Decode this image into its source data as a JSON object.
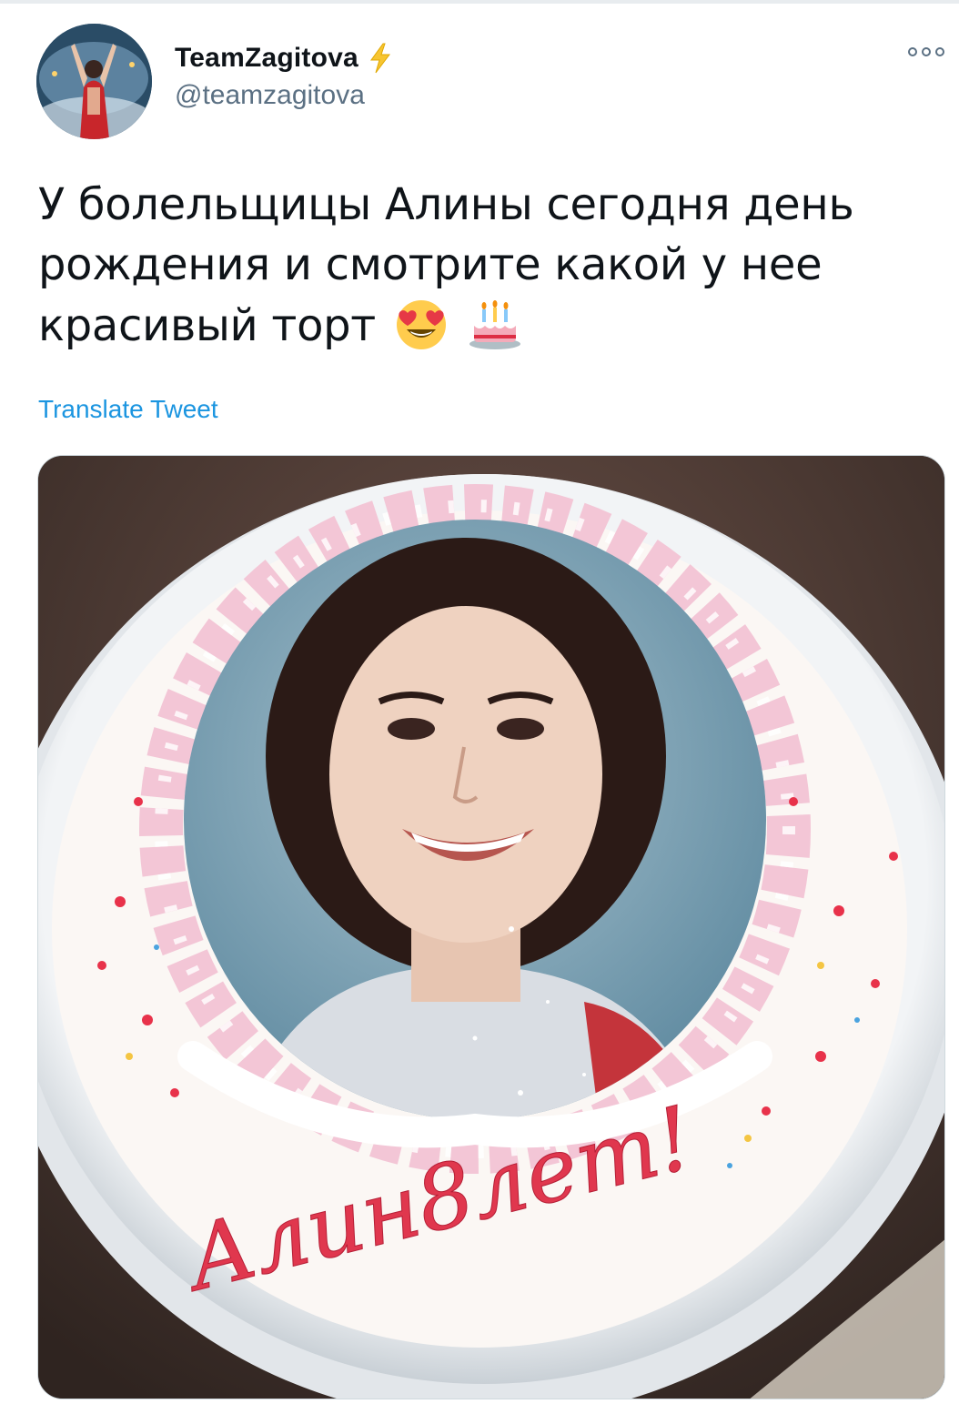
{
  "tweet": {
    "display_name": "TeamZagitova",
    "handle": "@teamzagitova",
    "text": "У болельщицы Алины сегодня день рождения и смотрите какой у нее красивый торт",
    "translate_label": "Translate Tweet",
    "emojis": [
      "heart-eyes-emoji",
      "birthday-cake-emoji"
    ],
    "verified_badge_icon": "lightning-bolt-icon",
    "accent_color": "#1b95e0",
    "handle_color": "#5b7083"
  },
  "media": {
    "cake_inscription": "Алин8лет!"
  }
}
